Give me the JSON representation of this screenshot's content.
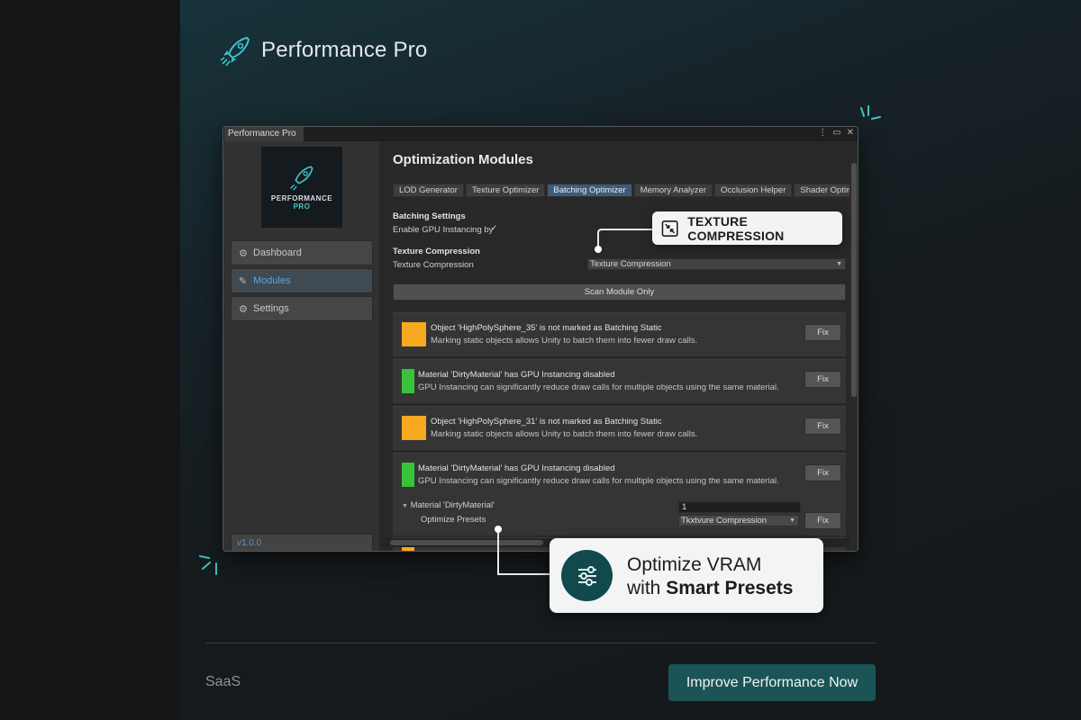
{
  "brand": {
    "title": "Performance Pro"
  },
  "window": {
    "tab_title": "Performance Pro",
    "controls": [
      "⋮",
      "▭",
      "✕"
    ],
    "splash": {
      "line1": "PERFORMANCE",
      "line2": "PRO"
    },
    "nav": [
      {
        "label": "Dashboard",
        "icon": "gear-icon",
        "active": false
      },
      {
        "label": "Modules",
        "icon": "wand-icon",
        "active": true
      },
      {
        "label": "Settings",
        "icon": "gear-icon",
        "active": false
      }
    ],
    "version": "v1.0.0"
  },
  "main": {
    "heading": "Optimization Modules",
    "tabs": [
      "LOD Generator",
      "Texture Optimizer",
      "Batching Optimizer",
      "Memory Analyzer",
      "Occlusion Helper",
      "Shader Optimizer"
    ],
    "active_tab": "Batching Optimizer",
    "batching_settings_label": "Batching Settings",
    "gpu_instancing_label": "Enable GPU Instancing by",
    "gpu_instancing_checked": true,
    "texture_compression_heading": "Texture Compression",
    "texture_compression_label": "Texture Compression",
    "texture_compression_value": "Texture Compression",
    "scan_button": "Scan Module Only",
    "issues": [
      {
        "color": "#f7a91f",
        "title": "Object 'HighPolySphere_35' is not marked as Batching Static",
        "desc": "Marking static objects allows Unity to batch them into fewer draw calls.",
        "fix": "Fix"
      },
      {
        "color": "#37c33a",
        "title": "Material 'DirtyMaterial' has GPU Instancing disabled",
        "desc": "GPU Instancing can significantly reduce draw calls for multiple objects using the same material.",
        "fix": "Fix"
      },
      {
        "color": "#f7a91f",
        "title": "Object 'HighPolySphere_31' is not marked as Batching Static",
        "desc": "Marking static objects allows Unity to batch them into fewer draw calls.",
        "fix": "Fix"
      },
      {
        "color": "#37c33a",
        "title": "Material 'DirtyMaterial' has GPU Instancing disabled",
        "desc": "GPU Instancing can significantly reduce draw calls for multiple objects using the same material.",
        "fix": "Fix"
      }
    ],
    "expanded": {
      "material_label": "Material 'DirtyMaterial'",
      "material_value": "1",
      "presets_label": "Optimize Presets",
      "presets_value": "Tkxtvure Compression",
      "fix": "Fix"
    }
  },
  "callouts": {
    "texture": "TEXTURE COMPRESSION",
    "vram_line1": "Optimize VRAM",
    "vram_line2_prefix": "with",
    "vram_line2_bold": "Smart Presets"
  },
  "footer": {
    "category": "SaaS",
    "cta": "Improve Performance Now"
  },
  "colors": {
    "accent": "#4dc9cc",
    "cta_bg": "#1b5457",
    "warning": "#f7a91f",
    "ok": "#37c33a"
  }
}
